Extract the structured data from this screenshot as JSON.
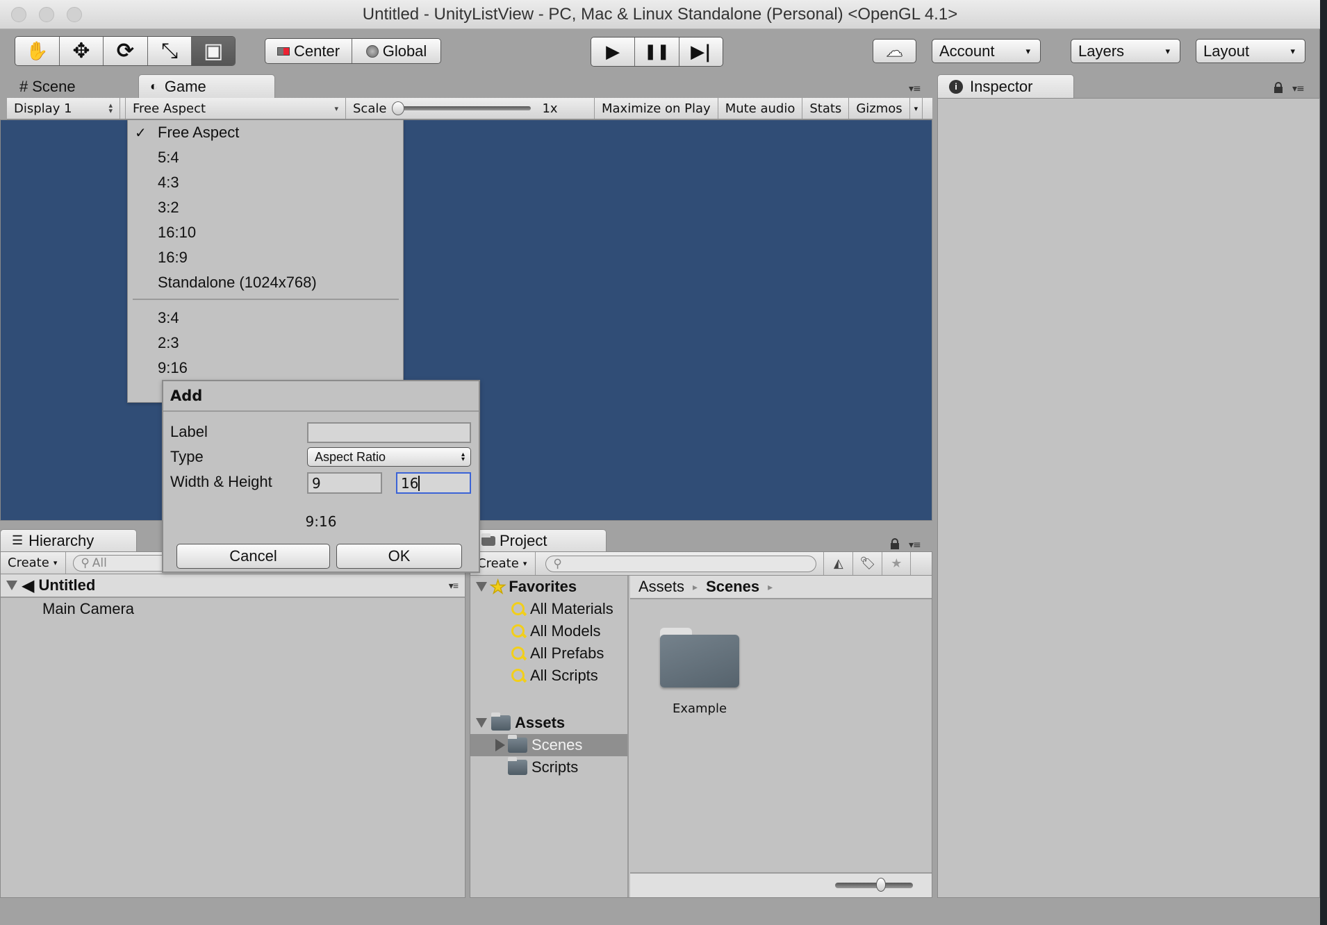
{
  "window": {
    "title": "Untitled - UnityListView - PC, Mac & Linux Standalone (Personal) <OpenGL 4.1>"
  },
  "toolbar": {
    "tools": [
      {
        "name": "hand-tool",
        "icon": "hand-icon",
        "glyph": "✋",
        "active": false
      },
      {
        "name": "move-tool",
        "icon": "move-icon",
        "glyph": "✥",
        "active": false
      },
      {
        "name": "rotate-tool",
        "icon": "rotate-icon",
        "glyph": "⟳",
        "active": false
      },
      {
        "name": "scale-tool",
        "icon": "scale-icon",
        "glyph": "⤡",
        "active": false
      },
      {
        "name": "rect-tool",
        "icon": "rect-tool-icon",
        "glyph": "▣",
        "active": true
      }
    ],
    "pivot_label": "Center",
    "space_label": "Global",
    "play_icon": "▶",
    "pause_icon": "❚❚",
    "step_icon": "▶|",
    "cloud_icon": "☁",
    "account_label": "Account",
    "layers_label": "Layers",
    "layout_label": "Layout",
    "caret": "▾"
  },
  "tabs": {
    "scene": "Scene",
    "game": "Game",
    "inspector": "Inspector",
    "hierarchy": "Hierarchy",
    "project": "Project",
    "scene_icon": "#",
    "game_icon": "◐",
    "inspector_icon": "i",
    "hierarchy_icon": "☰",
    "panel_menu": "▾≡",
    "lock_icon": "🔓"
  },
  "game_toolbar": {
    "display": "Display 1",
    "aspect": "Free Aspect",
    "scale_label": "Scale",
    "scale_value": "1x",
    "scale_fraction": 0.0,
    "maximize_on_play": "Maximize on Play",
    "mute_audio": "Mute audio",
    "stats": "Stats",
    "gizmos": "Gizmos"
  },
  "aspect_menu": {
    "checkmark": "✓",
    "selected": "Free Aspect",
    "items_builtin": [
      "Free Aspect",
      "5:4",
      "4:3",
      "3:2",
      "16:10",
      "16:9",
      "Standalone (1024x768)"
    ],
    "items_custom": [
      "3:4",
      "2:3",
      "9:16"
    ]
  },
  "add_dialog": {
    "title": "Add",
    "label_label": "Label",
    "label_value": "",
    "type_label": "Type",
    "type_value": "Aspect Ratio",
    "wh_label": "Width & Height",
    "width_value": "9",
    "height_value": "16",
    "preview": "9:16",
    "cancel": "Cancel",
    "ok": "OK"
  },
  "hierarchy": {
    "create_label": "Create",
    "search_placeholder": "All",
    "scene_name": "Untitled",
    "objects": [
      "Main Camera"
    ]
  },
  "project": {
    "create_label": "Create",
    "search_placeholder": "",
    "favorites_label": "Favorites",
    "favorites": [
      "All Materials",
      "All Models",
      "All Prefabs",
      "All Scripts"
    ],
    "assets_label": "Assets",
    "asset_folders": [
      {
        "name": "Scenes",
        "selected": true,
        "expandable": true
      },
      {
        "name": "Scripts",
        "selected": false,
        "expandable": false
      }
    ],
    "breadcrumb": [
      "Assets",
      "Scenes"
    ],
    "breadcrumb_sep": "▸",
    "items": [
      {
        "name": "Example",
        "type": "folder"
      }
    ],
    "zoom_slider_fraction": 0.6
  },
  "colors": {
    "game_background": "#304d76",
    "panel_background": "#c2c2c2",
    "chrome_background": "#a2a2a2",
    "selected_row": "#8f8f8f",
    "focus_border": "#3b63d6",
    "favorites_icon": "#f2cf1a"
  }
}
